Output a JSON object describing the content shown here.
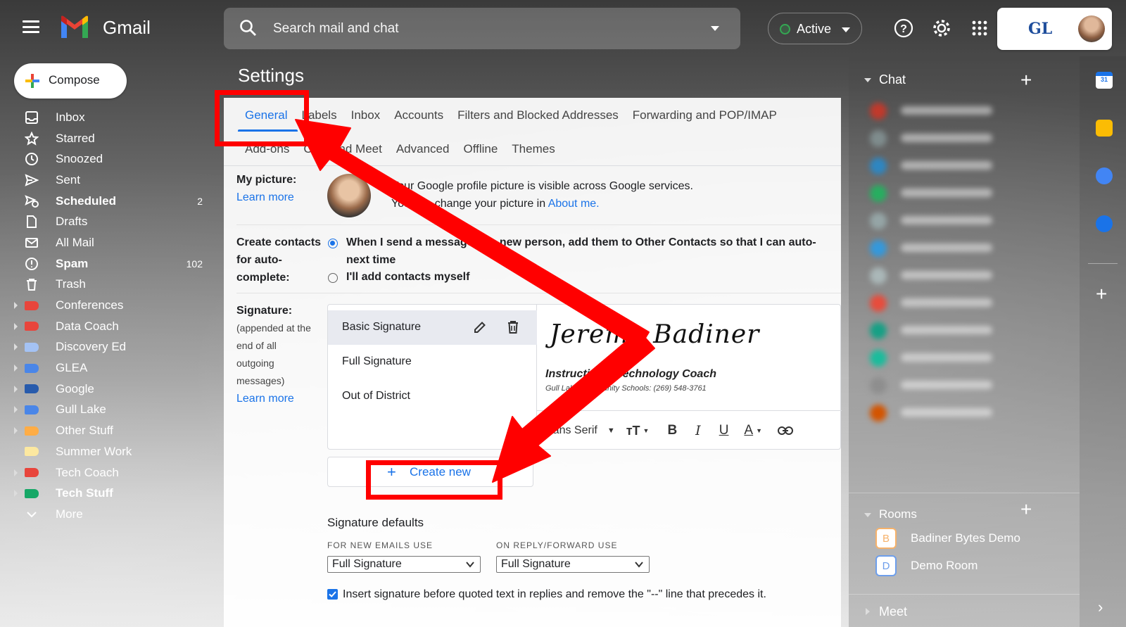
{
  "app": {
    "brand": "Gmail"
  },
  "search": {
    "placeholder": "Search mail and chat"
  },
  "status": {
    "label": "Active",
    "color": "#34a853"
  },
  "account": {
    "org_logo_text": "GL"
  },
  "compose": {
    "label": "Compose"
  },
  "nav": [
    {
      "label": "Inbox",
      "icon": "inbox-icon",
      "bold": false
    },
    {
      "label": "Starred",
      "icon": "star-icon",
      "bold": false
    },
    {
      "label": "Snoozed",
      "icon": "clock-icon",
      "bold": false
    },
    {
      "label": "Sent",
      "icon": "send-icon",
      "bold": false
    },
    {
      "label": "Scheduled",
      "icon": "scheduled-icon",
      "bold": true,
      "count": "2"
    },
    {
      "label": "Drafts",
      "icon": "draft-icon",
      "bold": false
    },
    {
      "label": "All Mail",
      "icon": "mail-icon",
      "bold": false
    },
    {
      "label": "Spam",
      "icon": "spam-icon",
      "bold": true,
      "count": "102"
    },
    {
      "label": "Trash",
      "icon": "trash-icon",
      "bold": false
    },
    {
      "label": "Conferences",
      "icon": "label-icon",
      "color": "#e8453c",
      "expandable": true
    },
    {
      "label": "Data Coach",
      "icon": "label-icon",
      "color": "#e8453c",
      "expandable": true
    },
    {
      "label": "Discovery Ed",
      "icon": "label-icon",
      "color": "#a4c2f4",
      "expandable": true
    },
    {
      "label": "GLEA",
      "icon": "label-icon",
      "color": "#4a86e8",
      "expandable": true
    },
    {
      "label": "Google",
      "icon": "label-icon",
      "color": "#285bac",
      "expandable": true
    },
    {
      "label": "Gull Lake",
      "icon": "label-icon",
      "color": "#4a86e8",
      "expandable": true
    },
    {
      "label": "Other Stuff",
      "icon": "label-icon",
      "color": "#ffad46",
      "expandable": true
    },
    {
      "label": "Summer Work",
      "icon": "label-icon",
      "color": "#fce8a0",
      "expandable": false
    },
    {
      "label": "Tech Coach",
      "icon": "label-icon",
      "color": "#e8453c",
      "expandable": true
    },
    {
      "label": "Tech Stuff",
      "icon": "label-icon",
      "color": "#16a766",
      "expandable": true,
      "bold": true
    },
    {
      "label": "More",
      "icon": "chevron-down-icon",
      "bold": false
    }
  ],
  "settings": {
    "title": "Settings",
    "tabs_row1": [
      "General",
      "Labels",
      "Inbox",
      "Accounts",
      "Filters and Blocked Addresses",
      "Forwarding and POP/IMAP"
    ],
    "tabs_row2": [
      "Add-ons",
      "Chat and Meet",
      "Advanced",
      "Offline",
      "Themes"
    ],
    "active_tab": "General",
    "my_picture": {
      "label": "My picture:",
      "learn_more": "Learn more",
      "line1": "Your Google profile picture is visible across Google services.",
      "line2_prefix": "You can change your picture in",
      "line2_link": "About me."
    },
    "create_contacts": {
      "label_line1": "Create contacts",
      "label_line2": "for auto-",
      "label_line3": "complete:",
      "option1_line1": "When I send a message to a new person, add them to Other Contacts so that I can auto-",
      "option1_line2": "next time",
      "option2": "I'll add contacts myself"
    },
    "signature": {
      "label": "Signature:",
      "desc": [
        "(appended at the",
        "end of all",
        "outgoing",
        "messages)"
      ],
      "learn_more": "Learn more",
      "items": [
        "Basic Signature",
        "Full Signature",
        "Out of District"
      ],
      "preview_name": "Jeremy Badiner",
      "preview_title": "Instructional Technology Coach",
      "preview_sub": "Gull Lake Community Schools: (269) 548-3761",
      "font": "Sans Serif",
      "create_new": "Create new"
    },
    "defaults": {
      "heading": "Signature defaults",
      "new_emails_label": "FOR NEW EMAILS USE",
      "new_emails_value": "Full Signature",
      "reply_label": "ON REPLY/FORWARD USE",
      "reply_value": "Full Signature",
      "checkbox_text": "Insert signature before quoted text in replies and remove the \"--\" line that precedes it."
    }
  },
  "chat": {
    "heading": "Chat",
    "rooms_heading": "Rooms",
    "rooms": [
      {
        "initial": "B",
        "name": "Badiner Bytes Demo",
        "color": "#f6b26b"
      },
      {
        "initial": "D",
        "name": "Demo Room",
        "color": "#6d9eeb"
      }
    ],
    "meet_heading": "Meet"
  }
}
